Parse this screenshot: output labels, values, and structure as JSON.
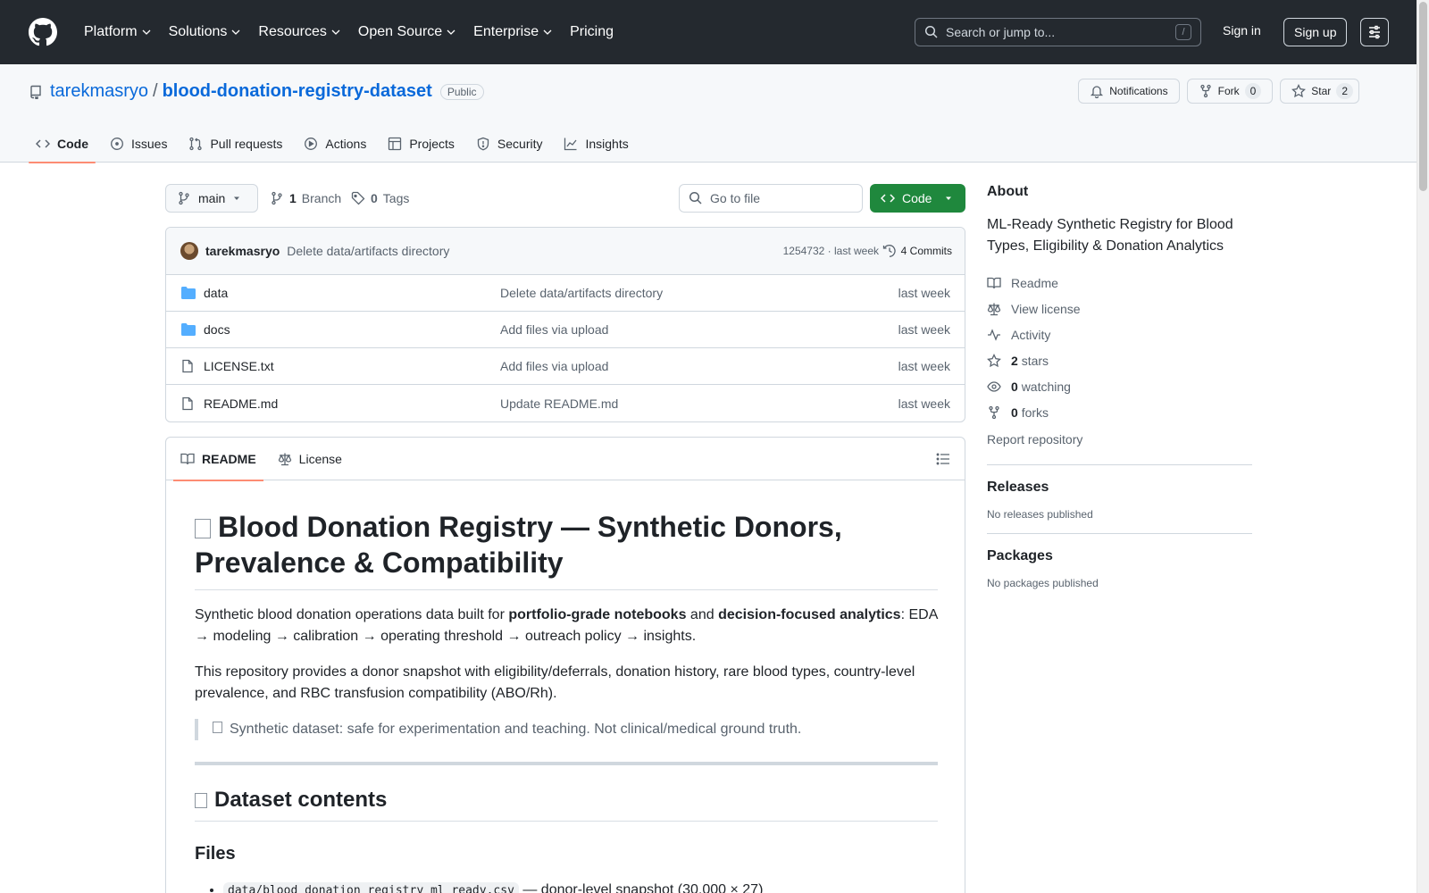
{
  "header": {
    "nav": [
      "Platform",
      "Solutions",
      "Resources",
      "Open Source",
      "Enterprise",
      "Pricing"
    ],
    "search_placeholder": "Search or jump to...",
    "search_shortcut": "/",
    "sign_in": "Sign in",
    "sign_up": "Sign up"
  },
  "repo": {
    "owner": "tarekmasryo",
    "separator": "/",
    "name": "blood-donation-registry-dataset",
    "visibility": "Public",
    "notifications": "Notifications",
    "fork_label": "Fork",
    "fork_count": "0",
    "star_label": "Star",
    "star_count": "2",
    "tabs": [
      "Code",
      "Issues",
      "Pull requests",
      "Actions",
      "Projects",
      "Security",
      "Insights"
    ]
  },
  "toolbar": {
    "branch": "main",
    "branch_count": "1",
    "branch_label": "Branch",
    "tag_count": "0",
    "tag_label": "Tags",
    "goto_placeholder": "Go to file",
    "code_label": "Code"
  },
  "commit": {
    "author": "tarekmasryo",
    "message": "Delete data/artifacts directory",
    "meta": "1254732 · last week",
    "count": "4 Commits"
  },
  "files": [
    {
      "name": "data",
      "type": "folder",
      "commit": "Delete data/artifacts directory",
      "date": "last week"
    },
    {
      "name": "docs",
      "type": "folder",
      "commit": "Add files via upload",
      "date": "last week"
    },
    {
      "name": "LICENSE.txt",
      "type": "file",
      "commit": "Add files via upload",
      "date": "last week"
    },
    {
      "name": "README.md",
      "type": "file",
      "commit": "Update README.md",
      "date": "last week"
    }
  ],
  "readme": {
    "tab_readme": "README",
    "tab_license": "License",
    "h1": "Blood Donation Registry — Synthetic Donors, Prevalence & Compatibility",
    "p1_a": "Synthetic blood donation operations data built for ",
    "p1_b": "portfolio-grade notebooks",
    "p1_c": " and ",
    "p1_d": "decision-focused analytics",
    "p1_e": ": EDA → modeling → calibration → operating threshold → outreach policy → insights.",
    "p2": "This repository provides a donor snapshot with eligibility/deferrals, donation history, rare blood types, country-level prevalence, and RBC transfusion compatibility (ABO/Rh).",
    "quote": "Synthetic dataset: safe for experimentation and teaching. Not clinical/medical ground truth.",
    "h2": "Dataset contents",
    "h3": "Files",
    "li1_code": "data/blood_donation_registry_ml_ready.csv",
    "li1_text": " — donor-level snapshot (30,000 × 27)"
  },
  "sidebar": {
    "about": "About",
    "description": "ML-Ready Synthetic Registry for Blood Types, Eligibility & Donation Analytics",
    "readme": "Readme",
    "license": "View license",
    "activity": "Activity",
    "stars_n": "2",
    "stars": "stars",
    "watching_n": "0",
    "watching": "watching",
    "forks_n": "0",
    "forks": "forks",
    "report": "Report repository",
    "releases": "Releases",
    "no_releases": "No releases published",
    "packages": "Packages",
    "no_packages": "No packages published"
  }
}
